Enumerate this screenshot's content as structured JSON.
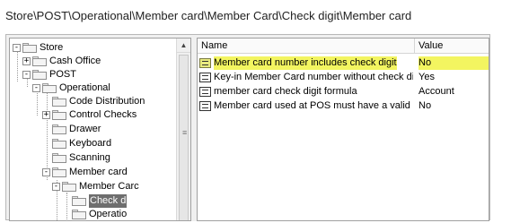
{
  "breadcrumb": "Store\\POST\\Operational\\Member card\\Member Card\\Check digit\\Member card",
  "tree": {
    "nodes": [
      {
        "label": "Store",
        "expander": "-"
      },
      {
        "label": "Cash Office",
        "expander": "+"
      },
      {
        "label": "POST",
        "expander": "-"
      },
      {
        "label": "Operational",
        "expander": "-"
      },
      {
        "label": "Code Distribution",
        "expander": ""
      },
      {
        "label": "Control Checks",
        "expander": "+"
      },
      {
        "label": "Drawer",
        "expander": ""
      },
      {
        "label": "Keyboard",
        "expander": ""
      },
      {
        "label": "Scanning",
        "expander": ""
      },
      {
        "label": "Member card",
        "expander": "-"
      },
      {
        "label": "Member Carc",
        "expander": "-"
      },
      {
        "label": "Check d",
        "expander": "",
        "selected": true
      },
      {
        "label": "Operatio",
        "expander": ""
      }
    ],
    "scroll_up_glyph": "▲",
    "scroll_grip_glyph": "≡"
  },
  "list": {
    "columns": {
      "name": "Name",
      "value": "Value"
    },
    "rows": [
      {
        "name": "Member card number includes check digit",
        "value": "No",
        "highlighted": true
      },
      {
        "name": "Key-in Member Card number without check di...",
        "value": "Yes"
      },
      {
        "name": "member card check digit formula",
        "value": "Account"
      },
      {
        "name": "Member card used at POS must have a valid ...",
        "value": "No"
      }
    ],
    "highlight_color": "#f3f560"
  }
}
